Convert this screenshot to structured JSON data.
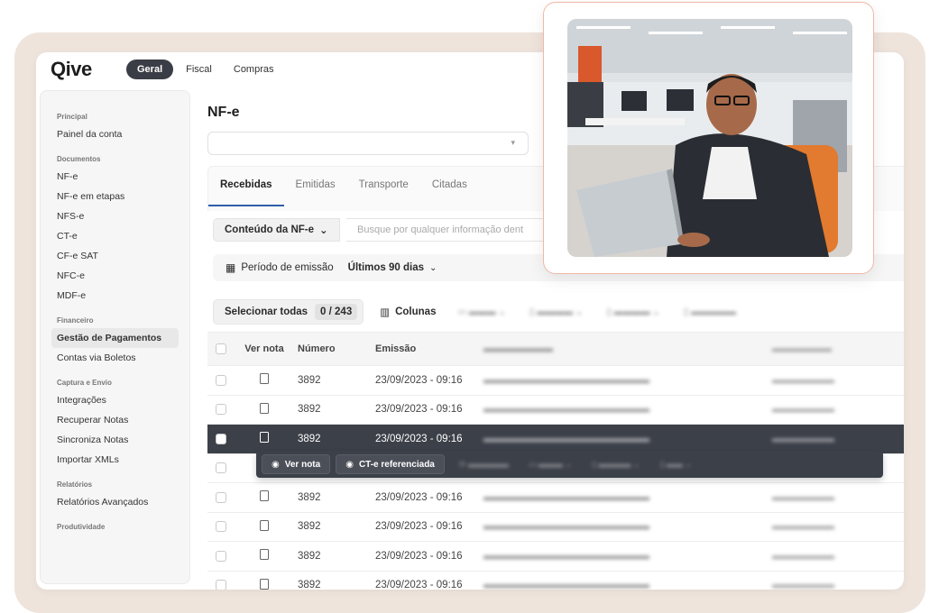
{
  "app": {
    "logo": "Qive",
    "top_tabs": [
      {
        "label": "Geral",
        "active": true
      },
      {
        "label": "Fiscal",
        "active": false
      },
      {
        "label": "Compras",
        "active": false
      }
    ]
  },
  "sidebar": {
    "sections": [
      {
        "title": "Principal",
        "items": [
          "Painel da conta"
        ]
      },
      {
        "title": "Documentos",
        "items": [
          "NF-e",
          "NF-e em etapas",
          "NFS-e",
          "CT-e",
          "CF-e SAT",
          "NFC-e",
          "MDF-e"
        ]
      },
      {
        "title": "Financeiro",
        "items": [
          "Gestão de Pagamentos",
          "Contas via Boletos"
        ]
      },
      {
        "title": "Captura e Envio",
        "items": [
          "Integrações",
          "Recuperar Notas",
          "Sincroniza Notas",
          "Importar XMLs"
        ]
      },
      {
        "title": "Relatórios",
        "items": [
          "Relatórios Avançados"
        ]
      },
      {
        "title": "Produtividade",
        "items": []
      }
    ],
    "active_item": "Gestão de Pagamentos"
  },
  "main": {
    "title": "NF-e",
    "tabs": [
      "Recebidas",
      "Emitidas",
      "Transporte",
      "Citadas"
    ],
    "active_tab": "Recebidas",
    "content_filter": "Conteúdo da NF-e",
    "search_placeholder": "Busque por qualquer informação dent",
    "period_label": "Período de emissão",
    "period_value": "Últimos 90 dias",
    "select_all": "Selecionar todas",
    "count": "0 / 243",
    "columns_button": "Colunas"
  },
  "table": {
    "headers": {
      "ver": "Ver nota",
      "numero": "Número",
      "emissao": "Emissão"
    },
    "rows": [
      {
        "numero": "3892",
        "emissao": "23/09/2023 - 09:16",
        "selected": false
      },
      {
        "numero": "3892",
        "emissao": "23/09/2023 - 09:16",
        "selected": false
      },
      {
        "numero": "3892",
        "emissao": "23/09/2023 - 09:16",
        "selected": true
      },
      {
        "numero": "",
        "emissao": "",
        "selected": false
      },
      {
        "numero": "3892",
        "emissao": "23/09/2023 - 09:16",
        "selected": false
      },
      {
        "numero": "3892",
        "emissao": "23/09/2023 - 09:16",
        "selected": false
      },
      {
        "numero": "3892",
        "emissao": "23/09/2023 - 09:16",
        "selected": false
      },
      {
        "numero": "3892",
        "emissao": "23/09/2023 - 09:16",
        "selected": false
      }
    ]
  },
  "context_bar": {
    "ver_nota": "Ver nota",
    "ct_ref": "CT-e referenciada"
  },
  "colors": {
    "accent": "#2f5ea8",
    "dark": "#3c4049",
    "backdrop": "#efe4dc",
    "card_border": "#f0b8a8"
  }
}
